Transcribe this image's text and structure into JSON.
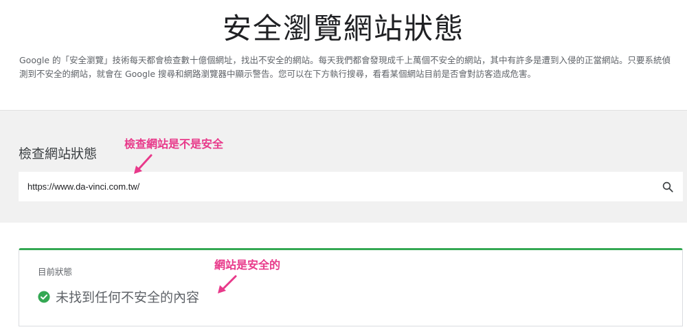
{
  "header": {
    "title": "安全瀏覽網站狀態",
    "intro": "Google 的「安全瀏覽」技術每天都會檢查數十億個網址，找出不安全的網站。每天我們都會發現成千上萬個不安全的網站，其中有許多是遭到入侵的正當網站。只要系統偵測到不安全的網站，就會在 Google 搜尋和網路瀏覽器中顯示警告。您可以在下方執行搜尋，看看某個網站目前是否會對訪客造成危害。"
  },
  "check": {
    "heading": "檢查網站狀態",
    "input_value": "https://www.da-vinci.com.tw/",
    "search_icon": "search-icon"
  },
  "status": {
    "label": "目前狀態",
    "result": "未找到任何不安全的內容",
    "result_icon": "check-circle-icon",
    "color": "#34a853"
  },
  "annotations": {
    "check_note": "檢查網站是不是安全",
    "status_note": "網站是安全的",
    "color": "#e8398a"
  }
}
